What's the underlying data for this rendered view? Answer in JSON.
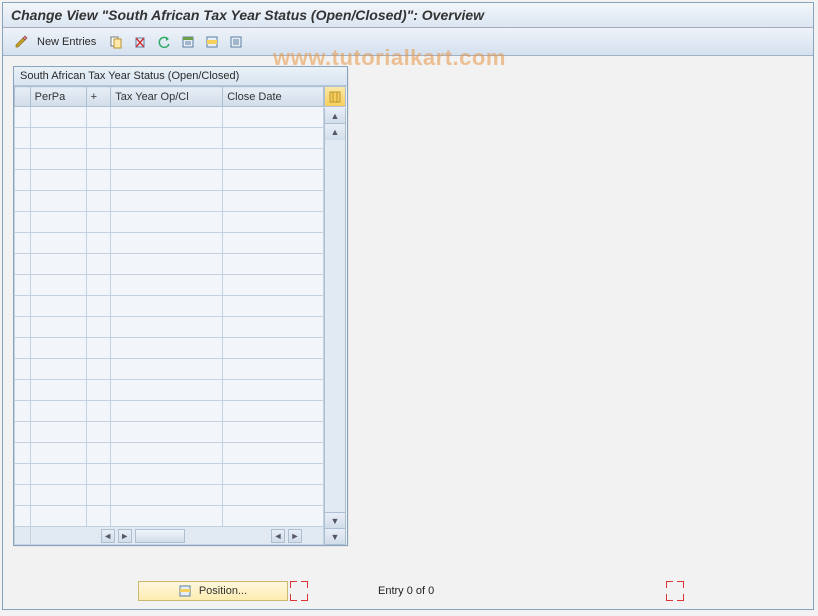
{
  "title": "Change View \"South African Tax Year Status (Open/Closed)\": Overview",
  "toolbar": {
    "new_entries_label": "New Entries"
  },
  "table": {
    "title": "South African Tax Year Status (Open/Closed)",
    "columns": {
      "perpa": "PerPa",
      "plus": "+",
      "taxyr": "Tax Year Op/Cl",
      "close": "Close Date"
    },
    "row_count": 20
  },
  "footer": {
    "position_label": "Position...",
    "entry_text": "Entry 0 of 0"
  },
  "watermark": "www.tutorialkart.com"
}
